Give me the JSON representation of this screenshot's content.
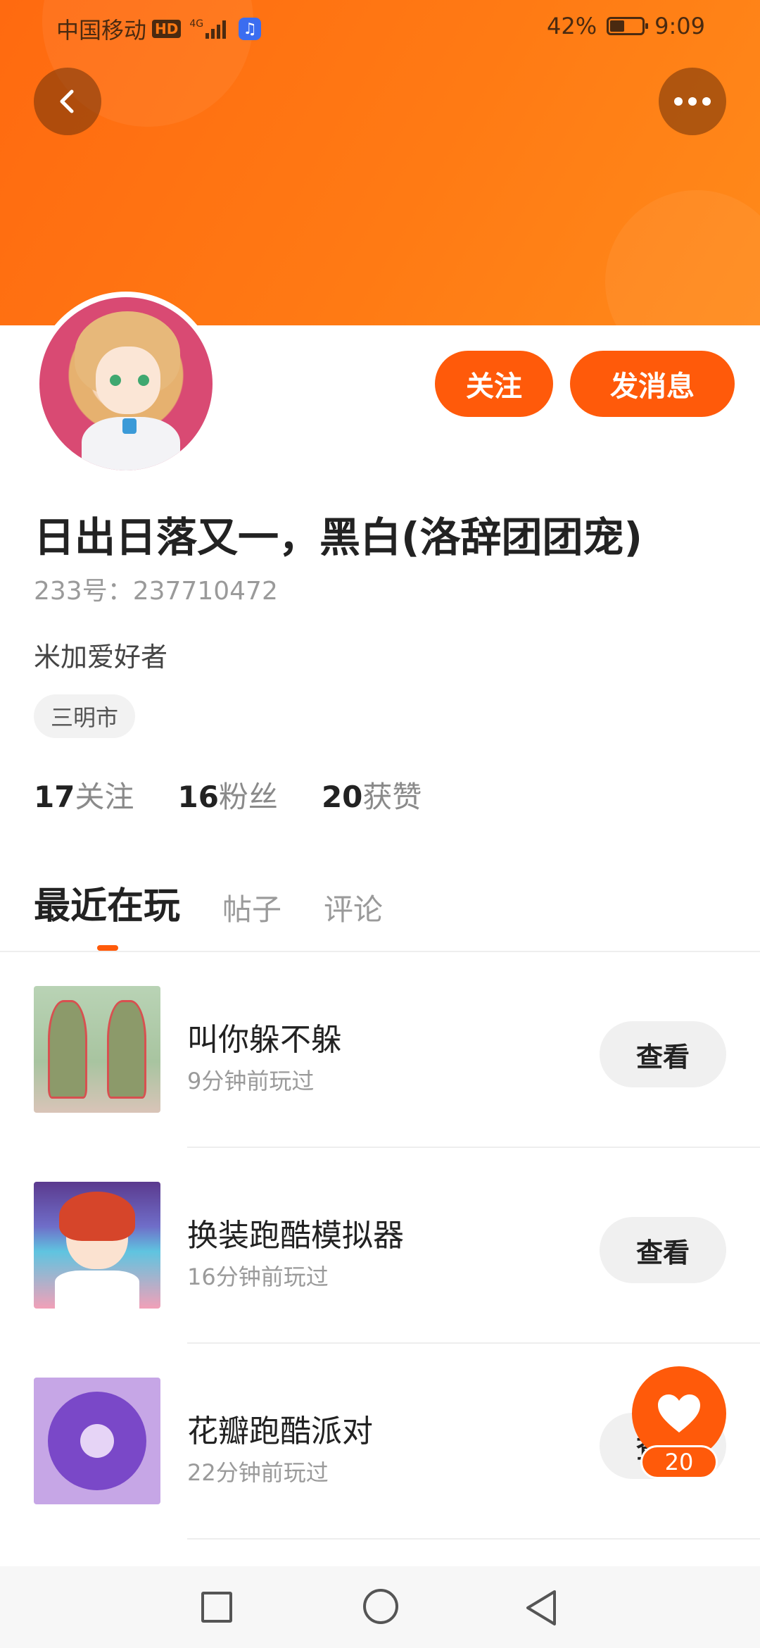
{
  "status_bar": {
    "carrier": "中国移动",
    "hd": "HD",
    "network": "4G",
    "battery_percent": "42%",
    "time": "9:09"
  },
  "header": {
    "back_icon": "chevron-left-icon",
    "more_icon": "more-dots-icon"
  },
  "profile": {
    "username": "日出日落又一，黑白(洛辞团团宠)",
    "uid": "233号：237710472",
    "bio": "米加爱好者",
    "location": "三明市",
    "follow_label": "关注",
    "message_label": "发消息",
    "stats": [
      {
        "num": "17",
        "label": "关注"
      },
      {
        "num": "16",
        "label": "粉丝"
      },
      {
        "num": "20",
        "label": "获赞"
      }
    ]
  },
  "tabs": [
    {
      "label": "最近在玩",
      "active": true
    },
    {
      "label": "帖子",
      "active": false
    },
    {
      "label": "评论",
      "active": false
    }
  ],
  "games": [
    {
      "title": "叫你躲不躲",
      "time": "9分钟前玩过",
      "action": "查看"
    },
    {
      "title": "换装跑酷模拟器",
      "time": "16分钟前玩过",
      "action": "查看"
    },
    {
      "title": "花瓣跑酷派对",
      "time": "22分钟前玩过",
      "action": "查看"
    }
  ],
  "like_fab": {
    "icon": "heart-icon",
    "count": "20"
  },
  "colors": {
    "accent": "#ff5a0a",
    "banner": "#ff7a14"
  }
}
